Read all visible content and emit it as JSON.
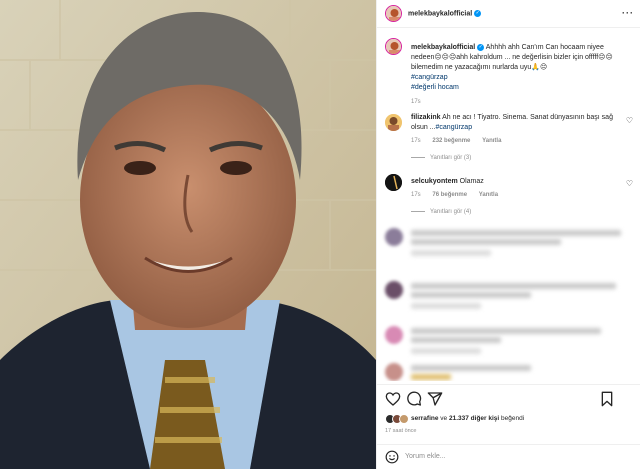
{
  "post": {
    "author": "melekbaykalofficial",
    "caption_author": "melekbaykalofficial",
    "caption_text": "Ahhhh ahh Can'ım Can hocaam niyee nedeen😔😔😔ahh kahroldum ... ne değerlisin bizler için offfff😔😔bilemedim ne yazacağımı nurlarda uyu🙏😔",
    "hashtags": [
      "#cangürzap",
      "#değerli hocam"
    ],
    "caption_time": "17s"
  },
  "comments": [
    {
      "username": "filizakink",
      "text": "Ah ne acı ! Tiyatro. Sinema. Sanat dünyasının başı sağ olsun ...",
      "hashtag": "#cangürzap",
      "time": "17s",
      "likes": "232 beğenme",
      "reply": "Yanıtla",
      "view_replies": "Yanıtları gör (3)"
    },
    {
      "username": "selcukyontem",
      "text": "Olamaz",
      "time": "17s",
      "likes": "76 beğenme",
      "reply": "Yanıtla",
      "view_replies": "Yanıtları gör (4)"
    }
  ],
  "likes_bar": {
    "first_liker": "serrafine",
    "and_text": "ve",
    "count": "21.337",
    "rest": "diğer kişi",
    "suffix": "beğendi",
    "posted_ago": "17 saat önce"
  },
  "add_comment": {
    "placeholder": "Yorum ekle..."
  },
  "icons": {
    "verified": "verified-badge-icon",
    "more": "more-options-icon",
    "heart": "heart-icon",
    "comment": "comment-icon",
    "share": "share-icon",
    "save": "bookmark-icon",
    "emoji": "emoji-icon"
  },
  "colors": {
    "accent_blue": "#0095f6",
    "link_blue": "#00376b",
    "muted": "#8e8e8e"
  }
}
